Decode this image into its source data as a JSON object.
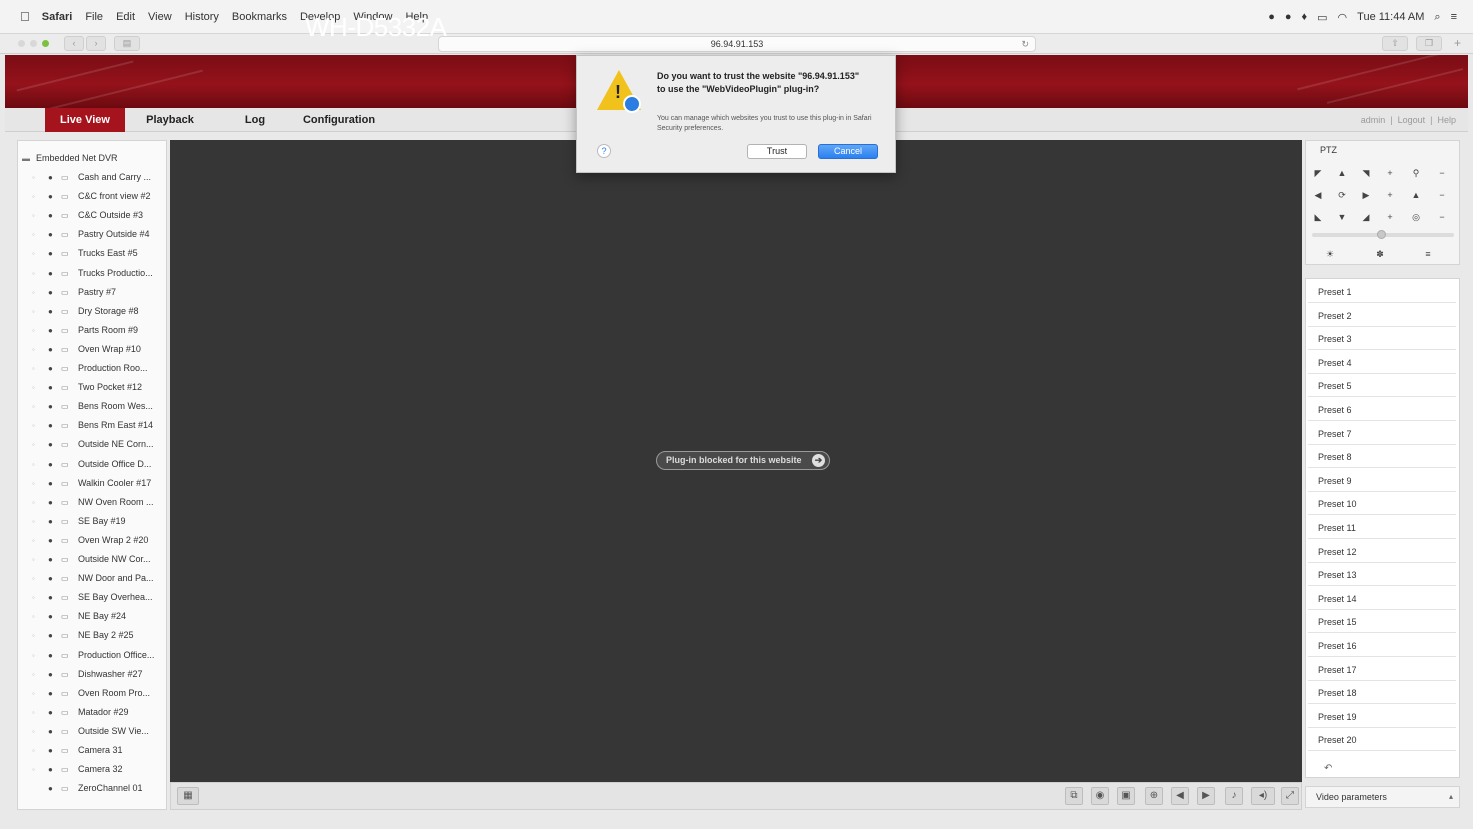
{
  "menubar": {
    "apple_icon": "apple-icon",
    "items": [
      "Safari",
      "File",
      "Edit",
      "View",
      "History",
      "Bookmarks",
      "Develop",
      "Window",
      "Help"
    ],
    "clock": "Tue 11:44 AM"
  },
  "browser": {
    "url": "96.94.91.153"
  },
  "app": {
    "brand": "WH-D5332A",
    "nav": [
      "Live View",
      "Playback",
      "Log",
      "Configuration"
    ],
    "nav_active": 0,
    "user": "admin",
    "logout": "Logout",
    "help": "Help"
  },
  "tree": {
    "root": "Embedded Net DVR",
    "cameras": [
      "Cash and Carry ...",
      "C&C front view #2",
      "C&C Outside #3",
      "Pastry Outside #4",
      "Trucks East #5",
      "Trucks Productio...",
      "Pastry #7",
      "Dry Storage #8",
      "Parts Room #9",
      "Oven Wrap #10",
      "Production Roo...",
      "Two Pocket #12",
      "Bens Room Wes...",
      "Bens Rm East #14",
      "Outside NE Corn...",
      "Outside Office D...",
      "Walkin Cooler #17",
      "NW Oven Room ...",
      "SE Bay #19",
      "Oven Wrap 2 #20",
      "Outside NW Cor...",
      "NW Door and Pa...",
      "SE Bay Overhea...",
      "NE Bay #24",
      "NE Bay 2 #25",
      "Production Office...",
      "Dishwasher #27",
      "Oven Room Pro...",
      "Matador #29",
      "Outside SW Vie...",
      "Camera 31",
      "Camera 32",
      "ZeroChannel 01"
    ]
  },
  "video": {
    "plugin_message": "Plug-in blocked for this website"
  },
  "ptz": {
    "title": "PTZ",
    "presets": [
      "Preset 1",
      "Preset 2",
      "Preset 3",
      "Preset 4",
      "Preset 5",
      "Preset 6",
      "Preset 7",
      "Preset 8",
      "Preset 9",
      "Preset 10",
      "Preset 11",
      "Preset 12",
      "Preset 13",
      "Preset 14",
      "Preset 15",
      "Preset 16",
      "Preset 17",
      "Preset 18",
      "Preset 19",
      "Preset 20"
    ],
    "video_parameters": "Video parameters"
  },
  "dialog": {
    "title": "Do you want to trust the website \"96.94.91.153\" to use the \"WebVideoPlugin\" plug-in?",
    "subtitle": "You can manage which websites you trust to use this plug-in in Safari Security preferences.",
    "trust_label": "Trust",
    "cancel_label": "Cancel",
    "help_label": "?"
  },
  "colors": {
    "brand_red": "#a5131d",
    "header_red": "#95121b",
    "video_bg": "#363636",
    "dialog_primary": "#2b7ff0"
  }
}
